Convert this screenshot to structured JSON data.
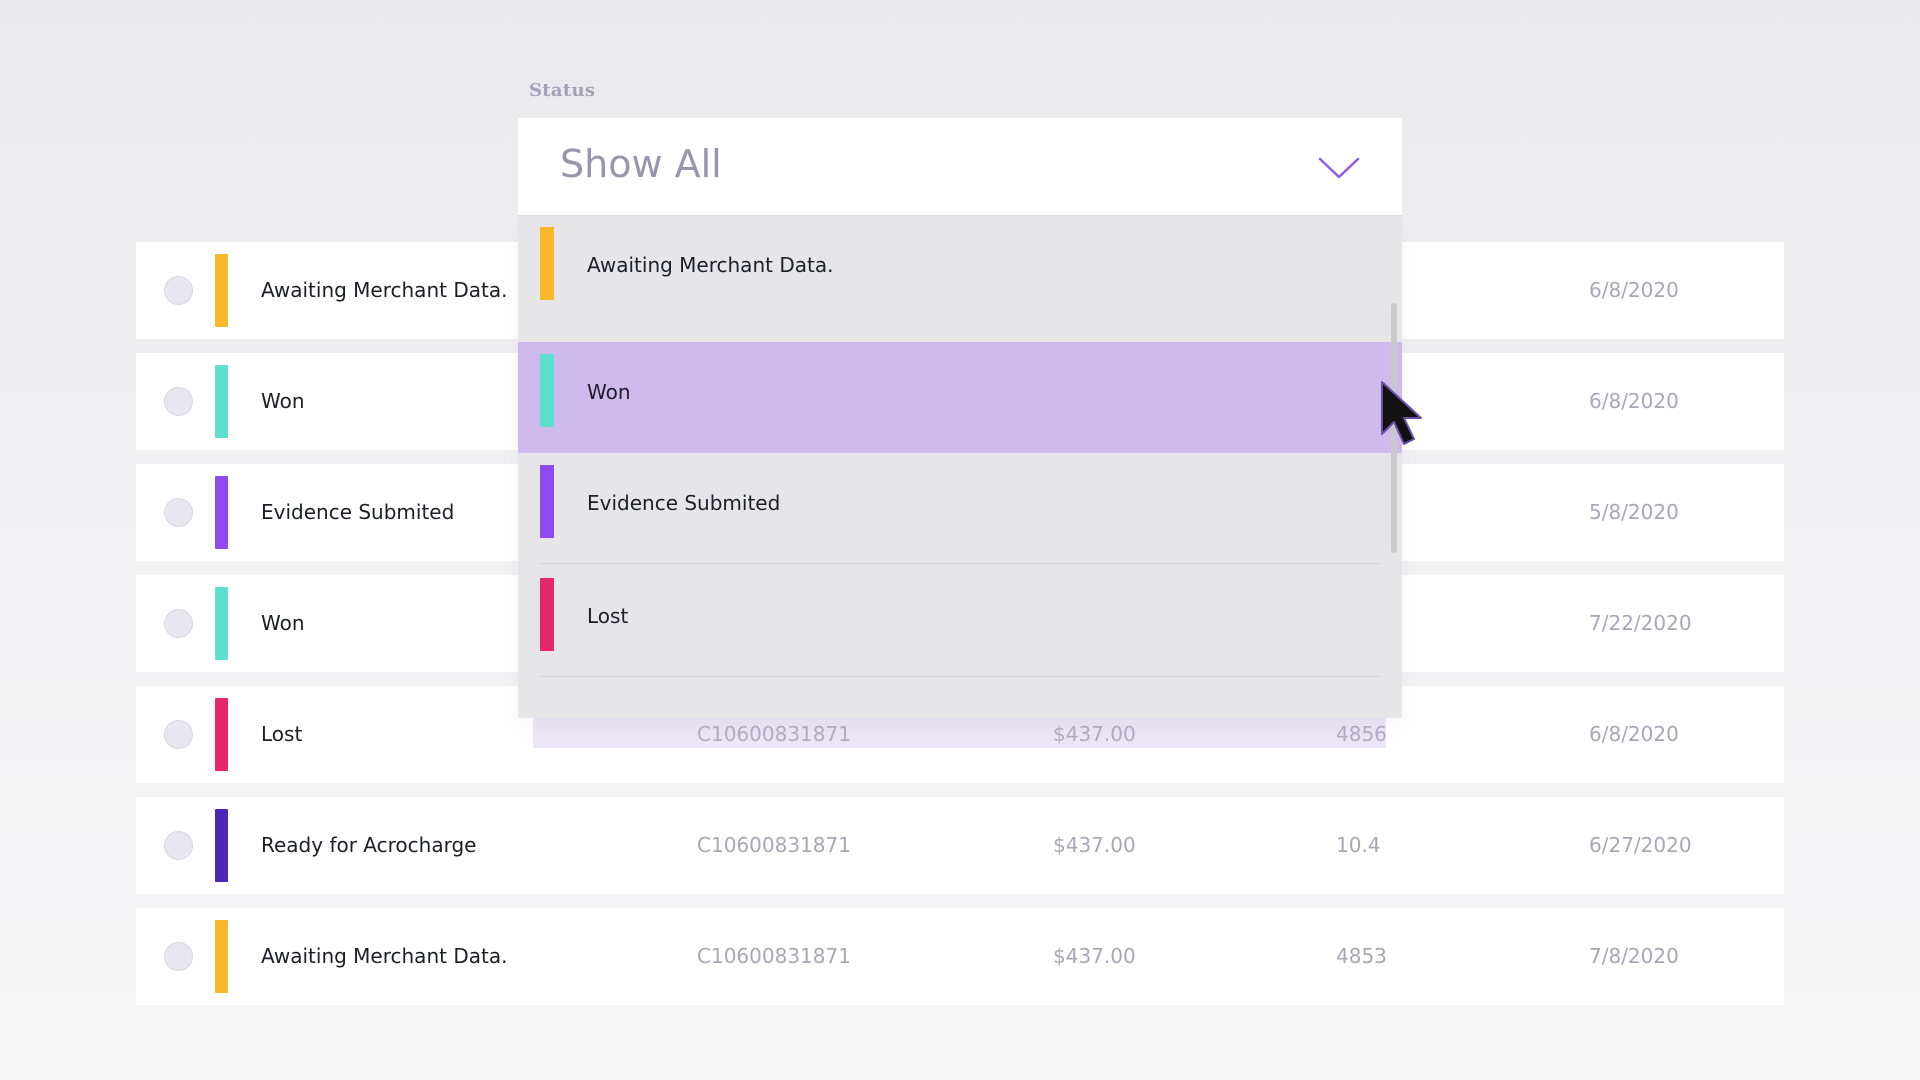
{
  "filter": {
    "label": "Status",
    "selected_value": "Show All",
    "options": [
      {
        "label": "Awaiting Merchant Data.",
        "color": "#f9b827"
      },
      {
        "label": "Won",
        "color": "#5ee0cf",
        "highlighted": true
      },
      {
        "label": "Evidence Submited",
        "color": "#9149f2"
      },
      {
        "label": "Lost",
        "color": "#e6276c"
      }
    ]
  },
  "rows": [
    {
      "status": "Awaiting Merchant Data.",
      "color": "#f9b827",
      "id": "",
      "amount": "",
      "code": "",
      "date": "6/8/2020"
    },
    {
      "status": "Won",
      "color": "#5ee0cf",
      "id": "",
      "amount": "",
      "code": "",
      "date": "6/8/2020"
    },
    {
      "status": "Evidence Submited",
      "color": "#9149f2",
      "id": "",
      "amount": "",
      "code": "",
      "date": "5/8/2020"
    },
    {
      "status": "Won",
      "color": "#5ee0cf",
      "id": "",
      "amount": "",
      "code": "",
      "date": "7/22/2020"
    },
    {
      "status": "Lost",
      "color": "#e6276c",
      "id": "C10600831871",
      "amount": "$437.00",
      "code": "4856",
      "date": "6/8/2020"
    },
    {
      "status": "Ready for Acrocharge",
      "color": "#4b26b8",
      "id": "C10600831871",
      "amount": "$437.00",
      "code": "10.4",
      "date": "6/27/2020"
    },
    {
      "status": "Awaiting Merchant Data.",
      "color": "#f9b827",
      "id": "C10600831871",
      "amount": "$437.00",
      "code": "4853",
      "date": "7/8/2020"
    }
  ],
  "icons": {
    "dropdown": "chevron-down-icon",
    "cursor": "mouse-pointer-icon"
  },
  "colors": {
    "accent": "#8e5ee6",
    "highlight": "#cfbaee"
  }
}
